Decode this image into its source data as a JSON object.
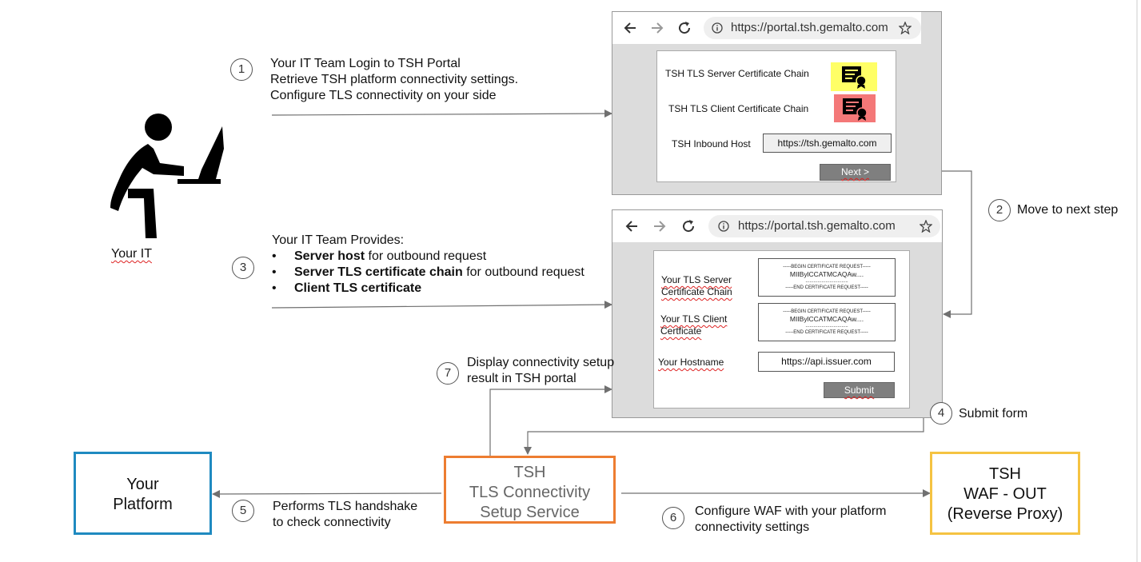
{
  "step1": {
    "number": "1",
    "line1": "Your IT Team Login to TSH Portal",
    "line2": "Retrieve TSH platform connectivity settings.",
    "line3": "Configure TLS connectivity on your side"
  },
  "step2": {
    "number": "2",
    "label": "Move to next step"
  },
  "step3": {
    "number": "3",
    "title": "Your IT Team Provides:",
    "bullets": [
      {
        "bullet": "•",
        "bold": "Server host",
        "rest": " for outbound request"
      },
      {
        "bullet": "•",
        "bold": "Server TLS certificate chain",
        "rest": " for outbound request"
      },
      {
        "bullet": "•",
        "bold": "Client TLS certificate",
        "rest": ""
      }
    ]
  },
  "step4": {
    "number": "4",
    "label": "Submit form"
  },
  "step5": {
    "number": "5",
    "line1": "Performs TLS handshake",
    "line2": "to check connectivity"
  },
  "step6": {
    "number": "6",
    "line1": "Configure WAF with your platform",
    "line2": "connectivity settings"
  },
  "step7": {
    "number": "7",
    "line1": "Display connectivity setup",
    "line2": "result in TSH portal"
  },
  "your_it": {
    "label": "Your IT"
  },
  "browser1": {
    "url": "https://portal.tsh.gemalto.com",
    "server_chain_label": "TSH TLS Server Certificate Chain",
    "client_chain_label": "TSH TLS Client Certificate Chain",
    "inbound_host_label": "TSH Inbound Host",
    "inbound_host_value": "https://tsh.gemalto.com",
    "next_button": "Next >",
    "server_cert_color": "#ffff66",
    "client_cert_color": "#f47878"
  },
  "browser2": {
    "url": "https://portal.tsh.gemalto.com",
    "server_chain_label1": "Your TLS Server",
    "server_chain_label2": "Certificate Chain",
    "client_cert_label1": "Your TLS Client",
    "client_cert_label2": "Certficate",
    "hostname_label": "Your Hostname",
    "hostname_value": "https://api.issuer.com",
    "cert_begin": "-----BEGIN CERTIFICATE REQUEST-----",
    "cert_body": "MIIBylCCATMCAQAw....",
    "cert_dots": "................................",
    "cert_end": "-----END CERTIFICATE REQUEST-----",
    "submit_button": "Submit"
  },
  "boxes": {
    "platform": {
      "line1": "Your",
      "line2": "Platform",
      "color": "#1f8ac0"
    },
    "tsh_service": {
      "line1": "TSH",
      "line2": "TLS Connectivity",
      "line3": "Setup Service",
      "color": "#ed7d31"
    },
    "waf": {
      "line1": "TSH",
      "line2": "WAF - OUT",
      "line3": "(Reverse Proxy)",
      "color": "#f5c342"
    }
  },
  "icons": {
    "person": "person-at-computer-icon",
    "back": "back-arrow-icon",
    "forward": "forward-arrow-icon",
    "reload": "reload-icon",
    "info": "info-icon",
    "star": "star-icon",
    "certificate": "certificate-icon"
  }
}
